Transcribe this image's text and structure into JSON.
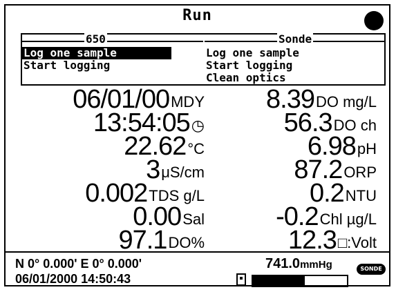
{
  "title": "Run",
  "menu": {
    "left": {
      "header": "650",
      "items": [
        "Log one sample",
        "Start logging"
      ],
      "selected": 0
    },
    "right": {
      "header": "Sonde",
      "items": [
        "Log one sample",
        "Start logging",
        "Clean optics"
      ]
    }
  },
  "readings_left": [
    {
      "value": "06/01/00",
      "unit": "MDY"
    },
    {
      "value": "13:54:05",
      "unit": "◷"
    },
    {
      "value": "22.62",
      "unit": "°C"
    },
    {
      "value": "3",
      "unit": "μS/cm"
    },
    {
      "value": "0.002",
      "unit": "TDS g/L"
    },
    {
      "value": "0.00",
      "unit": "Sal"
    },
    {
      "value": "97.1",
      "unit": "DO%"
    }
  ],
  "readings_right": [
    {
      "value": "8.39",
      "unit": "DO mg/L"
    },
    {
      "value": "56.3",
      "unit": "DO ch"
    },
    {
      "value": "6.98",
      "unit": "pH"
    },
    {
      "value": "87.2",
      "unit": "ORP"
    },
    {
      "value": "0.2",
      "unit": "NTU"
    },
    {
      "value": "-0.2",
      "unit": "Chl µg/L"
    },
    {
      "value": "12.3",
      "unit": "□:Volt"
    }
  ],
  "footer": {
    "gps": "N 0° 0.000' E  0° 0.000'",
    "datetime": "06/01/2000 14:50:43",
    "pressure_value": "741.0",
    "pressure_unit": "mmHg",
    "battery_level": 0.55,
    "sonde_badge": "SONDE"
  }
}
